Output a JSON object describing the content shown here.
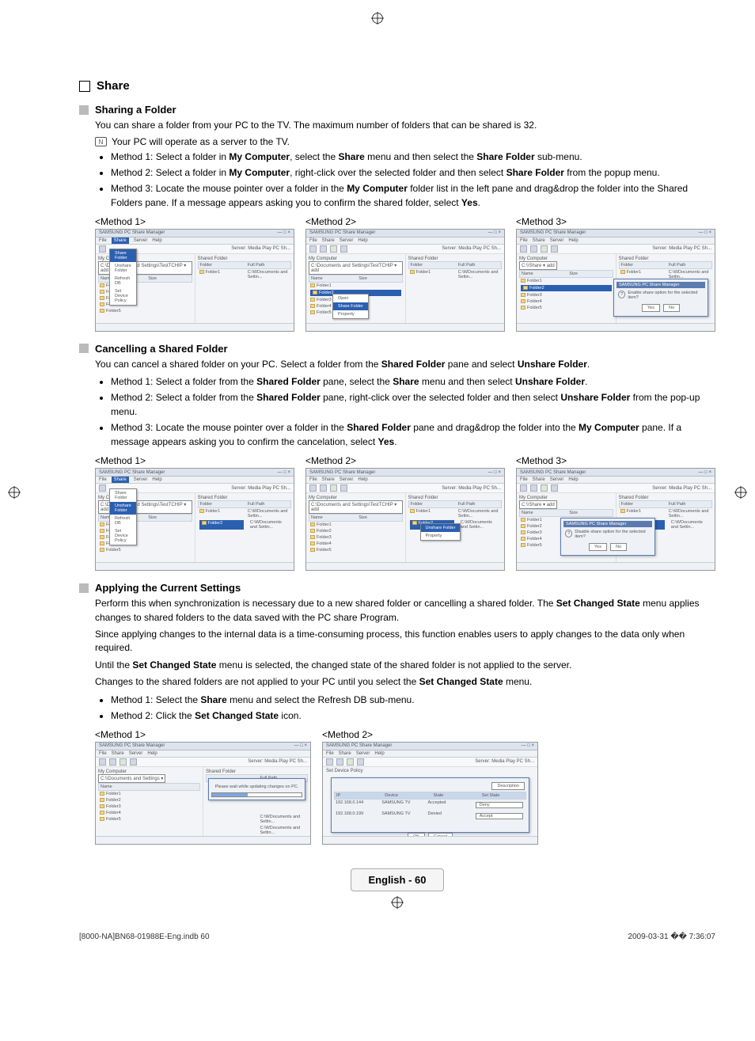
{
  "section": {
    "title": "Share"
  },
  "sharing": {
    "heading": "Sharing a Folder",
    "intro": "You can share a folder from your PC to the TV. The maximum number of folders that can be shared is 32.",
    "note": "Your PC will operate as a server to the TV.",
    "m1_a": "Method 1: Select a folder in ",
    "m1_b": "My Computer",
    "m1_c": ", select the ",
    "m1_d": "Share",
    "m1_e": " menu and then select the ",
    "m1_f": "Share Folder",
    "m1_g": " sub-menu.",
    "m2_a": "Method 2: Select a folder in ",
    "m2_b": "My Computer",
    "m2_c": ", right-click over the selected folder and then select ",
    "m2_d": "Share Folder",
    "m2_e": " from the popup menu.",
    "m3_a": "Method 3: Locate the mouse pointer over a folder in the ",
    "m3_b": "My Computer",
    "m3_c": " folder list in the left pane and drag&drop the folder into the Shared Folders pane. If a message appears asking you to confirm the shared folder, select ",
    "m3_d": "Yes",
    "m3_e": ".",
    "labels": {
      "m1": "<Method 1>",
      "m2": "<Method 2>",
      "m3": "<Method 3>"
    }
  },
  "cancel": {
    "heading": "Cancelling a Shared Folder",
    "intro_a": "You can cancel a shared folder on your PC. Select a folder from the ",
    "intro_b": "Shared Folder",
    "intro_c": " pane and select ",
    "intro_d": "Unshare Folder",
    "intro_e": ".",
    "m1_a": "Method 1: Select a folder from the ",
    "m1_b": "Shared Folder",
    "m1_c": " pane, select the ",
    "m1_d": "Share",
    "m1_e": " menu and then select ",
    "m1_f": "Unshare Folder",
    "m1_g": ".",
    "m2_a": "Method 2: Select a folder from the ",
    "m2_b": "Shared Folder",
    "m2_c": " pane, right-click over the selected folder and then select ",
    "m2_d": "Unshare Folder",
    "m2_e": " from the pop-up menu.",
    "m3_a": "Method 3: Locate the mouse pointer over a folder in the ",
    "m3_b": "Shared Folder",
    "m3_c": " pane and drag&drop the folder into the ",
    "m3_d": "My Computer",
    "m3_e": " pane. If a message appears asking you to confirm the cancelation, select ",
    "m3_f": "Yes",
    "m3_g": ".",
    "labels": {
      "m1": "<Method 1>",
      "m2": "<Method 2>",
      "m3": "<Method 3>"
    }
  },
  "apply": {
    "heading": "Applying the Current Settings",
    "p1_a": "Perform this when synchronization is necessary due to a new shared folder or cancelling a shared folder. The ",
    "p1_b": "Set Changed State",
    "p1_c": " menu applies changes to shared folders to the data saved with the PC share Program.",
    "p2": "Since applying changes to the internal data is a time-consuming process, this function enables users to apply changes to the data only when required.",
    "p3_a": "Until the ",
    "p3_b": "Set Changed State",
    "p3_c": " menu is selected, the changed state of the shared folder is not applied to the server.",
    "p4_a": "Changes to the shared folders are not applied to your PC until you select the ",
    "p4_b": "Set Changed State",
    "p4_c": " menu.",
    "m1_a": "Method 1: Select the ",
    "m1_b": "Share",
    "m1_c": " menu and select the Refresh DB sub-menu.",
    "m2_a": "Method 2: Click the ",
    "m2_b": "Set Changed State",
    "m2_c": " icon.",
    "labels": {
      "m1": "<Method 1>",
      "m2": "<Method 2>"
    }
  },
  "shot": {
    "app_title": "SAMSUNG PC Share Manager",
    "menus": {
      "file": "File",
      "share": "Share",
      "server": "Server",
      "help": "Help"
    },
    "server_label": "Server:",
    "server_value": "Media Play PC Sh...",
    "my_computer": "My Computer",
    "shared_folder": "Shared Folder",
    "col_name": "Name",
    "col_size": "Size",
    "col_folder": "Folder",
    "col_fullpath": "Full Path",
    "path1": "C:\\Documents and Settings\\TestTCHIP",
    "path2": "C:\\WDocuments and Settin...",
    "folders": [
      "Folder1",
      "Folder2",
      "Folder3",
      "Folder4",
      "Folder5"
    ],
    "shared_items": [
      "Folder1",
      "Folder2"
    ],
    "ctx_open": "Open",
    "ctx_share": "Share Folder",
    "ctx_unshare": "Unshare Folder",
    "ctx_prop": "Property",
    "share_menu_item": "Share Folder",
    "unshare_menu_item": "Unshare Folder",
    "refresh_db": "Refresh DB",
    "set_device": "Set Device Policy",
    "dlg_title": "SAMSUNG PC Share Manager",
    "dlg_enable": "Enable share option for the selected item?",
    "dlg_disable": "Disable share option for the selected item?",
    "yes": "Yes",
    "no": "No",
    "updating": "Please wait while updating changes on PC.",
    "dev_ip": "IP",
    "dev_device": "Device",
    "dev_state": "State",
    "dev_setstate": "Set State",
    "dev_rows": [
      {
        "ip": "192.168.0.144",
        "dev": "SAMSUNG TV",
        "state": "Accepted",
        "set": "Deny"
      },
      {
        "ip": "192.168.0.199",
        "dev": "SAMSUNG TV",
        "state": "Denied",
        "set": "Accept"
      }
    ],
    "ok": "OK",
    "cancel": "Cancel",
    "description": "Description",
    "go": "add"
  },
  "footer": {
    "page": "English - 60",
    "indb": "[8000-NA]BN68-01988E-Eng.indb   60",
    "ts": "2009-03-31   �� 7:36:07"
  }
}
